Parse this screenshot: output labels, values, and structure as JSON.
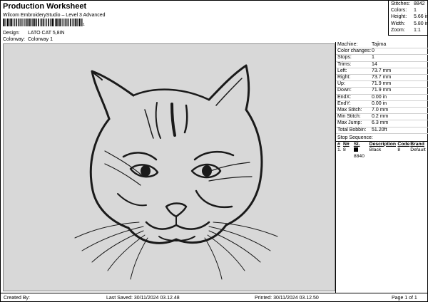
{
  "header": {
    "title": "Production Worksheet",
    "subtitle": "Wilcom EmbroideryStudio – Level 3 Advanced",
    "barcode_number": "1",
    "design_label": "Design:",
    "design_value": "LATO CAT 5,8IN",
    "colorway_label": "Colorway:",
    "colorway_value": "Colorway 1"
  },
  "stats": [
    {
      "label": "Stitches:",
      "value": "8842"
    },
    {
      "label": "Colors:",
      "value": "1"
    },
    {
      "label": "Height:",
      "value": "5.66 in"
    },
    {
      "label": "Width:",
      "value": "5.80 in"
    },
    {
      "label": "Zoom:",
      "value": "1:1"
    }
  ],
  "details": [
    {
      "label": "Machine:",
      "value": "Tajima"
    },
    {
      "label": "Color changes:",
      "value": "0"
    },
    {
      "label": "Stops:",
      "value": "1"
    },
    {
      "label": "Trims:",
      "value": "14"
    },
    {
      "label": "Left:",
      "value": "73.7 mm"
    },
    {
      "label": "Right:",
      "value": "73.7 mm"
    },
    {
      "label": "Up:",
      "value": "71.9 mm"
    },
    {
      "label": "Down:",
      "value": "71.9 mm"
    },
    {
      "label": "EndX:",
      "value": "0.00 in"
    },
    {
      "label": "EndY:",
      "value": "0.00 in"
    },
    {
      "label": "Max Stitch:",
      "value": "7.0 mm"
    },
    {
      "label": "Min Stitch:",
      "value": "0.2 mm"
    },
    {
      "label": "Max Jump:",
      "value": "6.3 mm"
    },
    {
      "label": "Total Bobbin:",
      "value": "51.20ft"
    }
  ],
  "sequence": {
    "title": "Stop Sequence:",
    "headers": [
      "#",
      "N#",
      "St.",
      "Description",
      "Code",
      "Brand"
    ],
    "rows": [
      {
        "num": "1.",
        "needle": "8",
        "stitches": "8840",
        "description": "Black",
        "code": "8",
        "brand": "Default",
        "color": "#000000"
      }
    ]
  },
  "footer": {
    "created": "Created By:",
    "last_saved": "Last Saved: 30/11/2024 03.12.48",
    "printed": "Printed: 30/11/2024 03.12.50",
    "page": "Page 1 of 1"
  },
  "canvas": {
    "background": "#d8d8d8",
    "thread_color": "#1a1a1a"
  }
}
